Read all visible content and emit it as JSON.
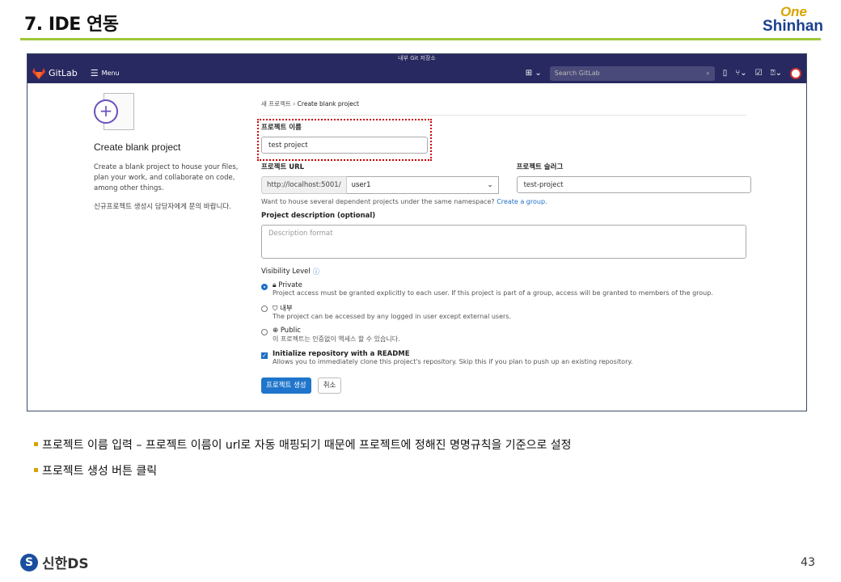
{
  "slide": {
    "title": "7. IDE 연동",
    "logo_top": "One",
    "logo_bottom": "Shinhan",
    "page_number": "43",
    "footer_brand": "신한DS"
  },
  "window": {
    "title": "내부 Git 저장소"
  },
  "nav": {
    "brand": "GitLab",
    "menu": "Menu",
    "search_placeholder": "Search GitLab"
  },
  "left": {
    "title": "Create blank project",
    "desc": "Create a blank project to house your files, plan your work, and collaborate on code, among other things.",
    "note": "신규프로젝트 생성시 담당자에게 문의 바랍니다."
  },
  "form": {
    "breadcrumb_parent": "새 프로젝트",
    "breadcrumb_sep": "›",
    "breadcrumb_current": "Create blank project",
    "name_label": "프로젝트 이름",
    "name_value": "test project",
    "url_label": "프로젝트 URL",
    "url_prefix": "http://localhost:5001/",
    "url_namespace": "user1",
    "slug_label": "프로젝트 슬러그",
    "slug_value": "test-project",
    "namespace_help": "Want to house several dependent projects under the same namespace?",
    "namespace_link": "Create a group.",
    "desc_label": "Project description (optional)",
    "desc_placeholder": "Description format",
    "visibility_label": "Visibility Level",
    "visibility": [
      {
        "title": "Private",
        "desc": "Project access must be granted explicitly to each user. If this project is part of a group, access will be granted to members of the group.",
        "selected": true
      },
      {
        "title": "내부",
        "desc": "The project can be accessed by any logged in user except external users.",
        "selected": false
      },
      {
        "title": "Public",
        "desc": "이 프로젝트는 인증없이 액세스 할 수 있습니다.",
        "selected": false
      }
    ],
    "readme_label": "Initialize repository with a README",
    "readme_desc": "Allows you to immediately clone this project's repository. Skip this if you plan to push up an existing repository.",
    "create_button": "프로젝트 생성",
    "cancel_button": "취소"
  },
  "notes": [
    "프로젝트 이름 입력 – 프로젝트 이름이 url로 자동 매핑되기 때문에 프로젝트에 정해진 명명규칙을 기준으로 설정",
    "프로젝트 생성 버튼 클릭"
  ]
}
